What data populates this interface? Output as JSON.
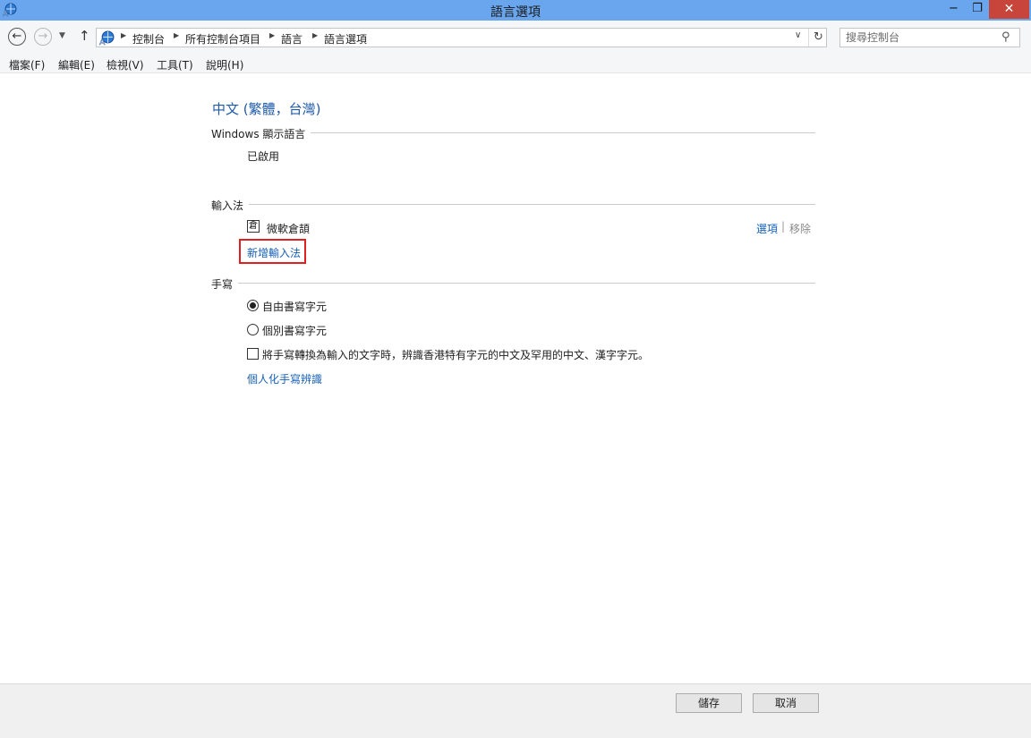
{
  "window": {
    "title": "語言選項",
    "minimize": "−",
    "maximize": "❐",
    "close": "✕"
  },
  "nav": {
    "back": "←",
    "forward": "→",
    "recent": "▼",
    "up": "↑"
  },
  "address": {
    "breadcrumbs": [
      "控制台",
      "所有控制台項目",
      "語言",
      "語言選項"
    ],
    "dropdown": "∨",
    "refresh": "↻"
  },
  "search": {
    "placeholder": "搜尋控制台",
    "icon": "⚲"
  },
  "menu": [
    "檔案(F)",
    "編輯(E)",
    "檢視(V)",
    "工具(T)",
    "說明(H)"
  ],
  "content": {
    "language_title": "中文 (繁體，台灣)",
    "display_language": {
      "heading": "Windows 顯示語言",
      "status": "已啟用"
    },
    "input_methods": {
      "heading": "輸入法",
      "items": [
        {
          "icon_glyph": "倉",
          "name": "微軟倉頡",
          "options_link": "選項",
          "separator": "|",
          "remove_link": "移除"
        }
      ],
      "add_link": "新增輸入法"
    },
    "handwriting": {
      "heading": "手寫",
      "options": [
        {
          "label": "自由書寫字元",
          "checked": true
        },
        {
          "label": "個別書寫字元",
          "checked": false
        }
      ],
      "checkbox_label": "將手寫轉換為輸入的文字時，辨識香港特有字元的中文及罕用的中文、漢字字元。",
      "checkbox_checked": false,
      "personalize_link": "個人化手寫辨識"
    }
  },
  "footer": {
    "save": "儲存",
    "cancel": "取消"
  }
}
